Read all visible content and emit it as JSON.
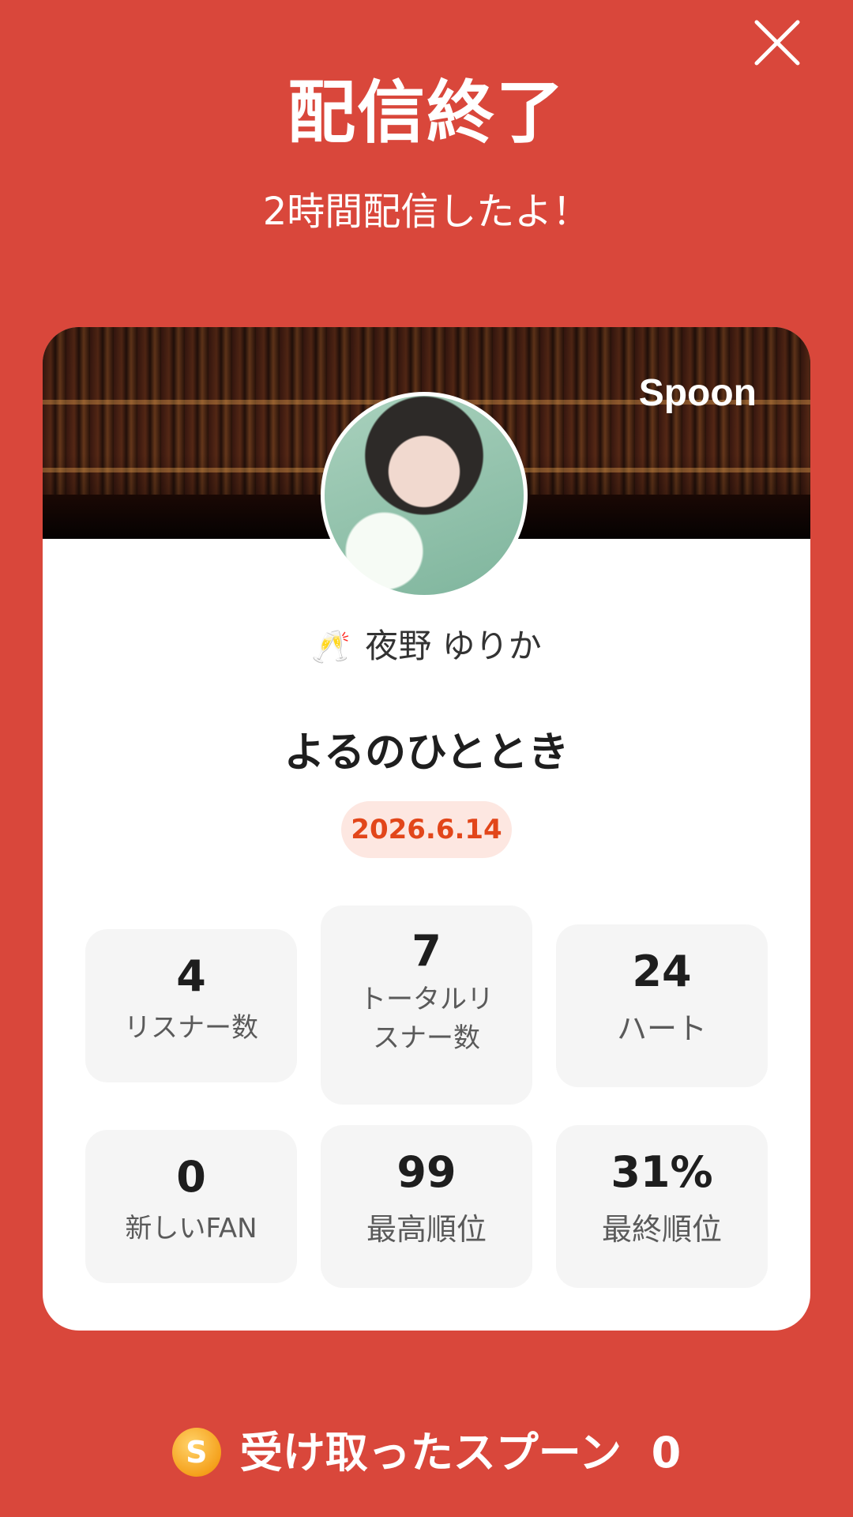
{
  "header": {
    "title": "配信終了",
    "subtitle": "2時間配信したよ！"
  },
  "card": {
    "brand": "Spoon",
    "username": "夜野 ゆりか",
    "badge_emoji": "🥂",
    "room_title": "よるのひととき",
    "date": "2026.6.14"
  },
  "stats": [
    {
      "value": "4",
      "label": "リスナー数"
    },
    {
      "value": "7",
      "label": "トータルリ\nスナー数"
    },
    {
      "value": "24",
      "label": "ハート"
    },
    {
      "value": "0",
      "label": "新しいFAN"
    },
    {
      "value": "99",
      "label": "最高順位"
    },
    {
      "value": "31%",
      "label": "最終順位"
    }
  ],
  "footer": {
    "coin_symbol": "S",
    "label": "受け取ったスプーン",
    "count": "0"
  },
  "colors": {
    "background": "#d9473b",
    "accent": "#e2461a",
    "date_pill_bg": "#fde7e1"
  },
  "icons": [
    "close-icon",
    "celebration-badge-icon",
    "spoon-coin-icon"
  ]
}
